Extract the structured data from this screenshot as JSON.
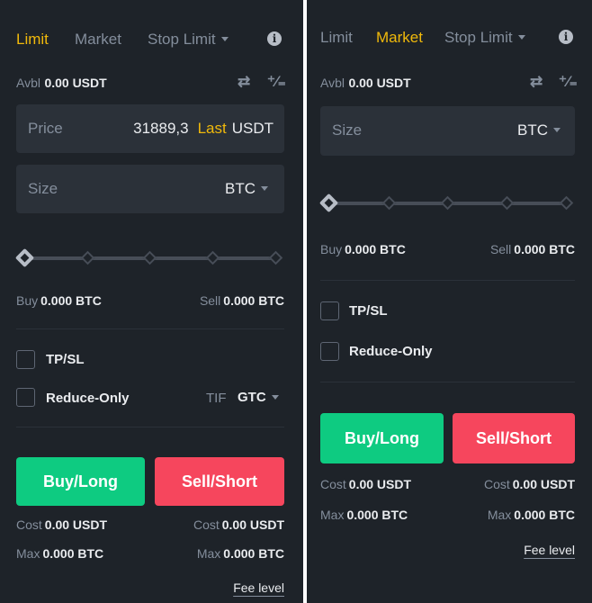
{
  "panels": [
    {
      "tabs": [
        {
          "label": "Limit",
          "active": true
        },
        {
          "label": "Market",
          "active": false
        },
        {
          "label": "Stop Limit",
          "active": false,
          "dropdown": true
        }
      ],
      "info_icon": "info-circle-icon",
      "avbl": {
        "label": "Avbl",
        "value": "0.00 USDT"
      },
      "icons": [
        "swap-arrows-icon",
        "percent-calculator-icon"
      ],
      "price": {
        "label": "Price",
        "value": "31889,3",
        "last_label": "Last",
        "unit": "USDT"
      },
      "size": {
        "label": "Size",
        "unit": "BTC"
      },
      "slider": {
        "value_percent": 0,
        "marks_percent": [
          0,
          25,
          50,
          75,
          100
        ]
      },
      "buy_amount": {
        "label": "Buy",
        "value": "0.000 BTC"
      },
      "sell_amount": {
        "label": "Sell",
        "value": "0.000 BTC"
      },
      "tpsl": {
        "label": "TP/SL",
        "checked": false
      },
      "reduce_only": {
        "label": "Reduce-Only",
        "checked": false
      },
      "tif": {
        "label": "TIF",
        "value": "GTC"
      },
      "buy_button": "Buy/Long",
      "sell_button": "Sell/Short",
      "buy_cost": {
        "label": "Cost",
        "value": "0.00 USDT"
      },
      "sell_cost": {
        "label": "Cost",
        "value": "0.00 USDT"
      },
      "buy_max": {
        "label": "Max",
        "value": "0.000 BTC"
      },
      "sell_max": {
        "label": "Max",
        "value": "0.000 BTC"
      },
      "fee_level": "Fee level"
    },
    {
      "tabs": [
        {
          "label": "Limit",
          "active": false
        },
        {
          "label": "Market",
          "active": true
        },
        {
          "label": "Stop Limit",
          "active": false,
          "dropdown": true
        }
      ],
      "info_icon": "info-circle-icon",
      "avbl": {
        "label": "Avbl",
        "value": "0.00 USDT"
      },
      "icons": [
        "swap-arrows-icon",
        "percent-calculator-icon"
      ],
      "size": {
        "label": "Size",
        "unit": "BTC"
      },
      "slider": {
        "value_percent": 0,
        "marks_percent": [
          0,
          25,
          50,
          75,
          100
        ]
      },
      "buy_amount": {
        "label": "Buy",
        "value": "0.000 BTC"
      },
      "sell_amount": {
        "label": "Sell",
        "value": "0.000 BTC"
      },
      "tpsl": {
        "label": "TP/SL",
        "checked": false
      },
      "reduce_only": {
        "label": "Reduce-Only",
        "checked": false
      },
      "buy_button": "Buy/Long",
      "sell_button": "Sell/Short",
      "buy_cost": {
        "label": "Cost",
        "value": "0.00 USDT"
      },
      "sell_cost": {
        "label": "Cost",
        "value": "0.00 USDT"
      },
      "buy_max": {
        "label": "Max",
        "value": "0.000 BTC"
      },
      "sell_max": {
        "label": "Max",
        "value": "0.000 BTC"
      },
      "fee_level": "Fee level"
    }
  ]
}
